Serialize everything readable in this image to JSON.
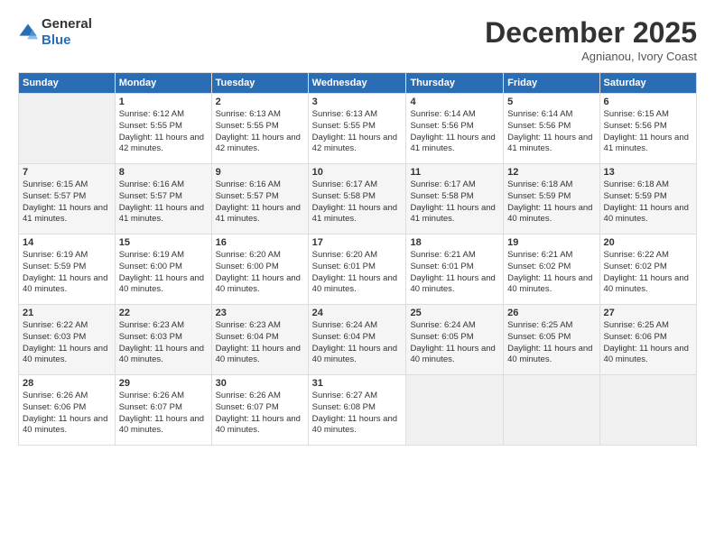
{
  "header": {
    "logo_general": "General",
    "logo_blue": "Blue",
    "month": "December 2025",
    "location": "Agnianou, Ivory Coast"
  },
  "days_of_week": [
    "Sunday",
    "Monday",
    "Tuesday",
    "Wednesday",
    "Thursday",
    "Friday",
    "Saturday"
  ],
  "weeks": [
    [
      {
        "day": "",
        "empty": true
      },
      {
        "day": "1",
        "sunrise": "6:12 AM",
        "sunset": "5:55 PM",
        "daylight": "11 hours and 42 minutes."
      },
      {
        "day": "2",
        "sunrise": "6:13 AM",
        "sunset": "5:55 PM",
        "daylight": "11 hours and 42 minutes."
      },
      {
        "day": "3",
        "sunrise": "6:13 AM",
        "sunset": "5:55 PM",
        "daylight": "11 hours and 42 minutes."
      },
      {
        "day": "4",
        "sunrise": "6:14 AM",
        "sunset": "5:56 PM",
        "daylight": "11 hours and 41 minutes."
      },
      {
        "day": "5",
        "sunrise": "6:14 AM",
        "sunset": "5:56 PM",
        "daylight": "11 hours and 41 minutes."
      },
      {
        "day": "6",
        "sunrise": "6:15 AM",
        "sunset": "5:56 PM",
        "daylight": "11 hours and 41 minutes."
      }
    ],
    [
      {
        "day": "7",
        "sunrise": "6:15 AM",
        "sunset": "5:57 PM",
        "daylight": "11 hours and 41 minutes."
      },
      {
        "day": "8",
        "sunrise": "6:16 AM",
        "sunset": "5:57 PM",
        "daylight": "11 hours and 41 minutes."
      },
      {
        "day": "9",
        "sunrise": "6:16 AM",
        "sunset": "5:57 PM",
        "daylight": "11 hours and 41 minutes."
      },
      {
        "day": "10",
        "sunrise": "6:17 AM",
        "sunset": "5:58 PM",
        "daylight": "11 hours and 41 minutes."
      },
      {
        "day": "11",
        "sunrise": "6:17 AM",
        "sunset": "5:58 PM",
        "daylight": "11 hours and 41 minutes."
      },
      {
        "day": "12",
        "sunrise": "6:18 AM",
        "sunset": "5:59 PM",
        "daylight": "11 hours and 40 minutes."
      },
      {
        "day": "13",
        "sunrise": "6:18 AM",
        "sunset": "5:59 PM",
        "daylight": "11 hours and 40 minutes."
      }
    ],
    [
      {
        "day": "14",
        "sunrise": "6:19 AM",
        "sunset": "5:59 PM",
        "daylight": "11 hours and 40 minutes."
      },
      {
        "day": "15",
        "sunrise": "6:19 AM",
        "sunset": "6:00 PM",
        "daylight": "11 hours and 40 minutes."
      },
      {
        "day": "16",
        "sunrise": "6:20 AM",
        "sunset": "6:00 PM",
        "daylight": "11 hours and 40 minutes."
      },
      {
        "day": "17",
        "sunrise": "6:20 AM",
        "sunset": "6:01 PM",
        "daylight": "11 hours and 40 minutes."
      },
      {
        "day": "18",
        "sunrise": "6:21 AM",
        "sunset": "6:01 PM",
        "daylight": "11 hours and 40 minutes."
      },
      {
        "day": "19",
        "sunrise": "6:21 AM",
        "sunset": "6:02 PM",
        "daylight": "11 hours and 40 minutes."
      },
      {
        "day": "20",
        "sunrise": "6:22 AM",
        "sunset": "6:02 PM",
        "daylight": "11 hours and 40 minutes."
      }
    ],
    [
      {
        "day": "21",
        "sunrise": "6:22 AM",
        "sunset": "6:03 PM",
        "daylight": "11 hours and 40 minutes."
      },
      {
        "day": "22",
        "sunrise": "6:23 AM",
        "sunset": "6:03 PM",
        "daylight": "11 hours and 40 minutes."
      },
      {
        "day": "23",
        "sunrise": "6:23 AM",
        "sunset": "6:04 PM",
        "daylight": "11 hours and 40 minutes."
      },
      {
        "day": "24",
        "sunrise": "6:24 AM",
        "sunset": "6:04 PM",
        "daylight": "11 hours and 40 minutes."
      },
      {
        "day": "25",
        "sunrise": "6:24 AM",
        "sunset": "6:05 PM",
        "daylight": "11 hours and 40 minutes."
      },
      {
        "day": "26",
        "sunrise": "6:25 AM",
        "sunset": "6:05 PM",
        "daylight": "11 hours and 40 minutes."
      },
      {
        "day": "27",
        "sunrise": "6:25 AM",
        "sunset": "6:06 PM",
        "daylight": "11 hours and 40 minutes."
      }
    ],
    [
      {
        "day": "28",
        "sunrise": "6:26 AM",
        "sunset": "6:06 PM",
        "daylight": "11 hours and 40 minutes."
      },
      {
        "day": "29",
        "sunrise": "6:26 AM",
        "sunset": "6:07 PM",
        "daylight": "11 hours and 40 minutes."
      },
      {
        "day": "30",
        "sunrise": "6:26 AM",
        "sunset": "6:07 PM",
        "daylight": "11 hours and 40 minutes."
      },
      {
        "day": "31",
        "sunrise": "6:27 AM",
        "sunset": "6:08 PM",
        "daylight": "11 hours and 40 minutes."
      },
      {
        "day": "",
        "empty": true
      },
      {
        "day": "",
        "empty": true
      },
      {
        "day": "",
        "empty": true
      }
    ]
  ]
}
